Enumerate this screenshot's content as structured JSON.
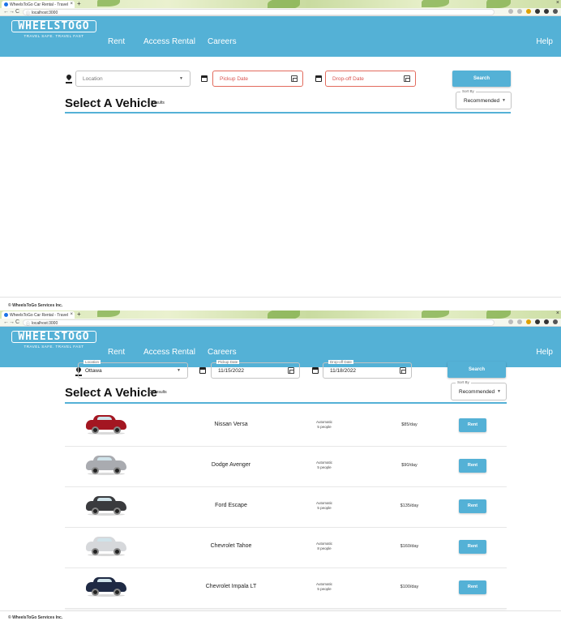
{
  "colors": {
    "brand": "#54b1d6",
    "error": "#e26b5d"
  },
  "browser": {
    "tab_title": "WheelsToGo Car Rental - Travel",
    "url": "localhost:3000"
  },
  "header": {
    "logo_text": "WHEELSTOGO",
    "logo_tagline": "TRAVEL SAFE. TRAVEL FAST",
    "nav": [
      "Rent",
      "Access Rental",
      "Careers"
    ],
    "help": "Help"
  },
  "screen1": {
    "location_placeholder": "Location",
    "pickup_placeholder": "Pickup Date",
    "dropoff_placeholder": "Drop-off Date",
    "search_label": "Search",
    "sort_label": "Sort By",
    "sort_value": "Recommended",
    "heading": "Select A Vehicle",
    "results": "0 Results"
  },
  "screen2": {
    "location_label": "Location",
    "location_value": "Ottawa",
    "pickup_label": "Pickup Date",
    "pickup_value": "11/15/2022",
    "dropoff_label": "Drop-off Date",
    "dropoff_value": "11/18/2022",
    "search_label": "Search",
    "sort_label": "Sort By",
    "sort_value": "Recommended",
    "heading": "Select A Vehicle",
    "results": "13 Results"
  },
  "vehicles": [
    {
      "name": "Nissan Versa",
      "transmission": "Automatic",
      "capacity": "5 people",
      "price": "$85/day",
      "rent": "Rent",
      "color": "#a31621",
      "icon": "red-hatchback-car-icon"
    },
    {
      "name": "Dodge Avenger",
      "transmission": "Automatic",
      "capacity": "5 people",
      "price": "$90/day",
      "rent": "Rent",
      "color": "#a9abb0",
      "icon": "silver-sedan-car-icon"
    },
    {
      "name": "Ford Escape",
      "transmission": "Automatic",
      "capacity": "5 people",
      "price": "$135/day",
      "rent": "Rent",
      "color": "#3a3b3e",
      "icon": "dark-suv-car-icon"
    },
    {
      "name": "Chevrolet Tahoe",
      "transmission": "Automatic",
      "capacity": "8 people",
      "price": "$160/day",
      "rent": "Rent",
      "color": "#d6d8db",
      "icon": "white-suv-car-icon"
    },
    {
      "name": "Chevrolet Impala LT",
      "transmission": "Automatic",
      "capacity": "5 people",
      "price": "$100/day",
      "rent": "Rent",
      "color": "#1f2a44",
      "icon": "navy-sedan-car-icon"
    }
  ],
  "footer": "© WheelsToGo Services Inc."
}
